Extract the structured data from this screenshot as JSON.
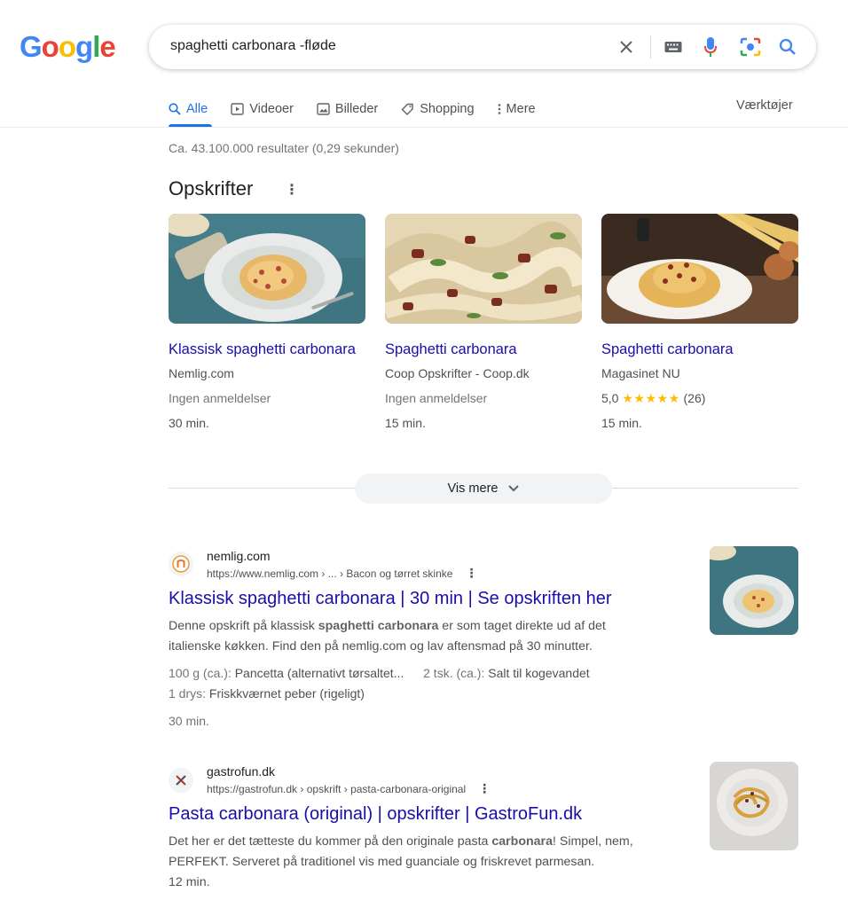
{
  "logo": {
    "letters": [
      "G",
      "o",
      "o",
      "g",
      "l",
      "e"
    ],
    "colors": [
      "#4285f4",
      "#ea4335",
      "#fbbc05",
      "#4285f4",
      "#34a853",
      "#ea4335"
    ]
  },
  "search": {
    "query": "spaghetti carbonara -fløde"
  },
  "tabs": [
    {
      "label": "Alle",
      "icon": "search-icon",
      "active": true
    },
    {
      "label": "Videoer",
      "icon": "video-icon"
    },
    {
      "label": "Billeder",
      "icon": "image-icon"
    },
    {
      "label": "Shopping",
      "icon": "tag-icon"
    },
    {
      "label": "Mere",
      "icon": "more-vert-icon"
    }
  ],
  "tools_label": "Værktøjer",
  "stats": "Ca. 43.100.000 resultater (0,29 sekunder)",
  "recipes": {
    "title": "Opskrifter",
    "more_icon": "⋮",
    "cards": [
      {
        "title": "Klassisk spaghetti carbonara",
        "source": "Nemlig.com",
        "reviews": "Ingen anmeldelser",
        "time": "30 min."
      },
      {
        "title": "Spaghetti carbonara",
        "source": "Coop Opskrifter - Coop.dk",
        "reviews": "Ingen anmeldelser",
        "time": "15 min."
      },
      {
        "title": "Spaghetti carbonara",
        "source": "Magasinet NU",
        "rating": "5,0",
        "stars": "★★★★★",
        "count": "(26)",
        "time": "15 min."
      }
    ],
    "show_more": "Vis mere"
  },
  "results": [
    {
      "site": "nemlig.com",
      "url": "https://www.nemlig.com › ... › Bacon og tørret skinke",
      "title": "Klassisk spaghetti carbonara | 30 min | Se opskriften her",
      "snippet_1a": "Denne opskrift på klassisk ",
      "snippet_1b": "spaghetti carbonara",
      "snippet_1c": " er som taget direkte ud af det",
      "snippet_2": "italienske køkken. Find den på nemlig.com og lav aftensmad på 30 minutter.",
      "ing1_k": "100 g (ca.): ",
      "ing1_v": "Pancetta (alternativt tørsaltet...",
      "ing2_k": "2 tsk. (ca.): ",
      "ing2_v": "Salt til kogevandet",
      "ing3_k": "1 drys: ",
      "ing3_v": "Friskkværnet peber (rigeligt)",
      "time": "30 min."
    },
    {
      "site": "gastrofun.dk",
      "url": "https://gastrofun.dk › opskrift › pasta-carbonara-original",
      "title": "Pasta carbonara (original) | opskrifter | GastroFun.dk",
      "snippet_1a": "Det her er det tætteste du kommer på den originale pasta ",
      "snippet_1b": "carbonara",
      "snippet_1c": "! Simpel, nem,",
      "snippet_2": "PERFEKT. Serveret på traditionel vis med guanciale og friskrevet parmesan.",
      "time": "12 min."
    }
  ]
}
